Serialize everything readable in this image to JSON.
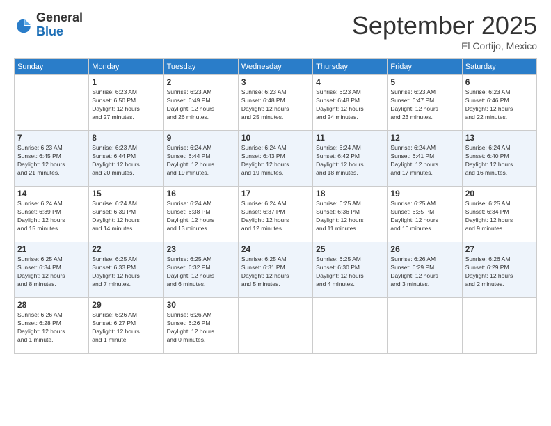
{
  "logo": {
    "general": "General",
    "blue": "Blue"
  },
  "header": {
    "month": "September 2025",
    "location": "El Cortijo, Mexico"
  },
  "weekdays": [
    "Sunday",
    "Monday",
    "Tuesday",
    "Wednesday",
    "Thursday",
    "Friday",
    "Saturday"
  ],
  "weeks": [
    [
      {
        "day": "",
        "info": ""
      },
      {
        "day": "1",
        "info": "Sunrise: 6:23 AM\nSunset: 6:50 PM\nDaylight: 12 hours\nand 27 minutes."
      },
      {
        "day": "2",
        "info": "Sunrise: 6:23 AM\nSunset: 6:49 PM\nDaylight: 12 hours\nand 26 minutes."
      },
      {
        "day": "3",
        "info": "Sunrise: 6:23 AM\nSunset: 6:48 PM\nDaylight: 12 hours\nand 25 minutes."
      },
      {
        "day": "4",
        "info": "Sunrise: 6:23 AM\nSunset: 6:48 PM\nDaylight: 12 hours\nand 24 minutes."
      },
      {
        "day": "5",
        "info": "Sunrise: 6:23 AM\nSunset: 6:47 PM\nDaylight: 12 hours\nand 23 minutes."
      },
      {
        "day": "6",
        "info": "Sunrise: 6:23 AM\nSunset: 6:46 PM\nDaylight: 12 hours\nand 22 minutes."
      }
    ],
    [
      {
        "day": "7",
        "info": "Sunrise: 6:23 AM\nSunset: 6:45 PM\nDaylight: 12 hours\nand 21 minutes."
      },
      {
        "day": "8",
        "info": "Sunrise: 6:23 AM\nSunset: 6:44 PM\nDaylight: 12 hours\nand 20 minutes."
      },
      {
        "day": "9",
        "info": "Sunrise: 6:24 AM\nSunset: 6:44 PM\nDaylight: 12 hours\nand 19 minutes."
      },
      {
        "day": "10",
        "info": "Sunrise: 6:24 AM\nSunset: 6:43 PM\nDaylight: 12 hours\nand 19 minutes."
      },
      {
        "day": "11",
        "info": "Sunrise: 6:24 AM\nSunset: 6:42 PM\nDaylight: 12 hours\nand 18 minutes."
      },
      {
        "day": "12",
        "info": "Sunrise: 6:24 AM\nSunset: 6:41 PM\nDaylight: 12 hours\nand 17 minutes."
      },
      {
        "day": "13",
        "info": "Sunrise: 6:24 AM\nSunset: 6:40 PM\nDaylight: 12 hours\nand 16 minutes."
      }
    ],
    [
      {
        "day": "14",
        "info": "Sunrise: 6:24 AM\nSunset: 6:39 PM\nDaylight: 12 hours\nand 15 minutes."
      },
      {
        "day": "15",
        "info": "Sunrise: 6:24 AM\nSunset: 6:39 PM\nDaylight: 12 hours\nand 14 minutes."
      },
      {
        "day": "16",
        "info": "Sunrise: 6:24 AM\nSunset: 6:38 PM\nDaylight: 12 hours\nand 13 minutes."
      },
      {
        "day": "17",
        "info": "Sunrise: 6:24 AM\nSunset: 6:37 PM\nDaylight: 12 hours\nand 12 minutes."
      },
      {
        "day": "18",
        "info": "Sunrise: 6:25 AM\nSunset: 6:36 PM\nDaylight: 12 hours\nand 11 minutes."
      },
      {
        "day": "19",
        "info": "Sunrise: 6:25 AM\nSunset: 6:35 PM\nDaylight: 12 hours\nand 10 minutes."
      },
      {
        "day": "20",
        "info": "Sunrise: 6:25 AM\nSunset: 6:34 PM\nDaylight: 12 hours\nand 9 minutes."
      }
    ],
    [
      {
        "day": "21",
        "info": "Sunrise: 6:25 AM\nSunset: 6:34 PM\nDaylight: 12 hours\nand 8 minutes."
      },
      {
        "day": "22",
        "info": "Sunrise: 6:25 AM\nSunset: 6:33 PM\nDaylight: 12 hours\nand 7 minutes."
      },
      {
        "day": "23",
        "info": "Sunrise: 6:25 AM\nSunset: 6:32 PM\nDaylight: 12 hours\nand 6 minutes."
      },
      {
        "day": "24",
        "info": "Sunrise: 6:25 AM\nSunset: 6:31 PM\nDaylight: 12 hours\nand 5 minutes."
      },
      {
        "day": "25",
        "info": "Sunrise: 6:25 AM\nSunset: 6:30 PM\nDaylight: 12 hours\nand 4 minutes."
      },
      {
        "day": "26",
        "info": "Sunrise: 6:26 AM\nSunset: 6:29 PM\nDaylight: 12 hours\nand 3 minutes."
      },
      {
        "day": "27",
        "info": "Sunrise: 6:26 AM\nSunset: 6:29 PM\nDaylight: 12 hours\nand 2 minutes."
      }
    ],
    [
      {
        "day": "28",
        "info": "Sunrise: 6:26 AM\nSunset: 6:28 PM\nDaylight: 12 hours\nand 1 minute."
      },
      {
        "day": "29",
        "info": "Sunrise: 6:26 AM\nSunset: 6:27 PM\nDaylight: 12 hours\nand 1 minute."
      },
      {
        "day": "30",
        "info": "Sunrise: 6:26 AM\nSunset: 6:26 PM\nDaylight: 12 hours\nand 0 minutes."
      },
      {
        "day": "",
        "info": ""
      },
      {
        "day": "",
        "info": ""
      },
      {
        "day": "",
        "info": ""
      },
      {
        "day": "",
        "info": ""
      }
    ]
  ]
}
